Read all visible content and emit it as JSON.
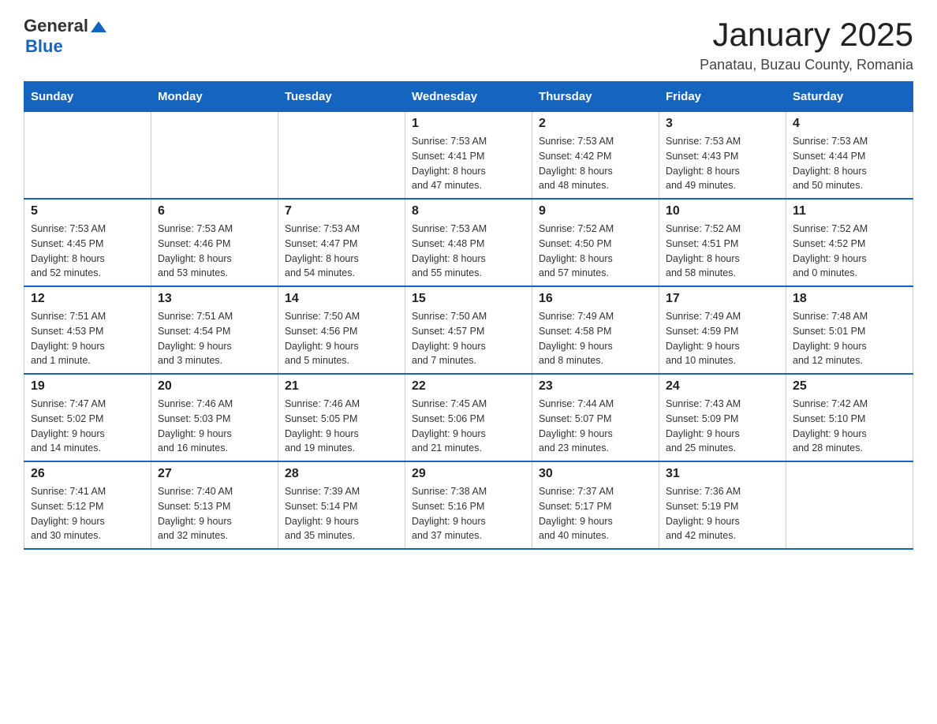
{
  "logo": {
    "text_general": "General",
    "text_blue": "Blue",
    "alt": "GeneralBlue logo"
  },
  "title": "January 2025",
  "subtitle": "Panatau, Buzau County, Romania",
  "days_of_week": [
    "Sunday",
    "Monday",
    "Tuesday",
    "Wednesday",
    "Thursday",
    "Friday",
    "Saturday"
  ],
  "weeks": [
    [
      {
        "day": "",
        "info": ""
      },
      {
        "day": "",
        "info": ""
      },
      {
        "day": "",
        "info": ""
      },
      {
        "day": "1",
        "info": "Sunrise: 7:53 AM\nSunset: 4:41 PM\nDaylight: 8 hours\nand 47 minutes."
      },
      {
        "day": "2",
        "info": "Sunrise: 7:53 AM\nSunset: 4:42 PM\nDaylight: 8 hours\nand 48 minutes."
      },
      {
        "day": "3",
        "info": "Sunrise: 7:53 AM\nSunset: 4:43 PM\nDaylight: 8 hours\nand 49 minutes."
      },
      {
        "day": "4",
        "info": "Sunrise: 7:53 AM\nSunset: 4:44 PM\nDaylight: 8 hours\nand 50 minutes."
      }
    ],
    [
      {
        "day": "5",
        "info": "Sunrise: 7:53 AM\nSunset: 4:45 PM\nDaylight: 8 hours\nand 52 minutes."
      },
      {
        "day": "6",
        "info": "Sunrise: 7:53 AM\nSunset: 4:46 PM\nDaylight: 8 hours\nand 53 minutes."
      },
      {
        "day": "7",
        "info": "Sunrise: 7:53 AM\nSunset: 4:47 PM\nDaylight: 8 hours\nand 54 minutes."
      },
      {
        "day": "8",
        "info": "Sunrise: 7:53 AM\nSunset: 4:48 PM\nDaylight: 8 hours\nand 55 minutes."
      },
      {
        "day": "9",
        "info": "Sunrise: 7:52 AM\nSunset: 4:50 PM\nDaylight: 8 hours\nand 57 minutes."
      },
      {
        "day": "10",
        "info": "Sunrise: 7:52 AM\nSunset: 4:51 PM\nDaylight: 8 hours\nand 58 minutes."
      },
      {
        "day": "11",
        "info": "Sunrise: 7:52 AM\nSunset: 4:52 PM\nDaylight: 9 hours\nand 0 minutes."
      }
    ],
    [
      {
        "day": "12",
        "info": "Sunrise: 7:51 AM\nSunset: 4:53 PM\nDaylight: 9 hours\nand 1 minute."
      },
      {
        "day": "13",
        "info": "Sunrise: 7:51 AM\nSunset: 4:54 PM\nDaylight: 9 hours\nand 3 minutes."
      },
      {
        "day": "14",
        "info": "Sunrise: 7:50 AM\nSunset: 4:56 PM\nDaylight: 9 hours\nand 5 minutes."
      },
      {
        "day": "15",
        "info": "Sunrise: 7:50 AM\nSunset: 4:57 PM\nDaylight: 9 hours\nand 7 minutes."
      },
      {
        "day": "16",
        "info": "Sunrise: 7:49 AM\nSunset: 4:58 PM\nDaylight: 9 hours\nand 8 minutes."
      },
      {
        "day": "17",
        "info": "Sunrise: 7:49 AM\nSunset: 4:59 PM\nDaylight: 9 hours\nand 10 minutes."
      },
      {
        "day": "18",
        "info": "Sunrise: 7:48 AM\nSunset: 5:01 PM\nDaylight: 9 hours\nand 12 minutes."
      }
    ],
    [
      {
        "day": "19",
        "info": "Sunrise: 7:47 AM\nSunset: 5:02 PM\nDaylight: 9 hours\nand 14 minutes."
      },
      {
        "day": "20",
        "info": "Sunrise: 7:46 AM\nSunset: 5:03 PM\nDaylight: 9 hours\nand 16 minutes."
      },
      {
        "day": "21",
        "info": "Sunrise: 7:46 AM\nSunset: 5:05 PM\nDaylight: 9 hours\nand 19 minutes."
      },
      {
        "day": "22",
        "info": "Sunrise: 7:45 AM\nSunset: 5:06 PM\nDaylight: 9 hours\nand 21 minutes."
      },
      {
        "day": "23",
        "info": "Sunrise: 7:44 AM\nSunset: 5:07 PM\nDaylight: 9 hours\nand 23 minutes."
      },
      {
        "day": "24",
        "info": "Sunrise: 7:43 AM\nSunset: 5:09 PM\nDaylight: 9 hours\nand 25 minutes."
      },
      {
        "day": "25",
        "info": "Sunrise: 7:42 AM\nSunset: 5:10 PM\nDaylight: 9 hours\nand 28 minutes."
      }
    ],
    [
      {
        "day": "26",
        "info": "Sunrise: 7:41 AM\nSunset: 5:12 PM\nDaylight: 9 hours\nand 30 minutes."
      },
      {
        "day": "27",
        "info": "Sunrise: 7:40 AM\nSunset: 5:13 PM\nDaylight: 9 hours\nand 32 minutes."
      },
      {
        "day": "28",
        "info": "Sunrise: 7:39 AM\nSunset: 5:14 PM\nDaylight: 9 hours\nand 35 minutes."
      },
      {
        "day": "29",
        "info": "Sunrise: 7:38 AM\nSunset: 5:16 PM\nDaylight: 9 hours\nand 37 minutes."
      },
      {
        "day": "30",
        "info": "Sunrise: 7:37 AM\nSunset: 5:17 PM\nDaylight: 9 hours\nand 40 minutes."
      },
      {
        "day": "31",
        "info": "Sunrise: 7:36 AM\nSunset: 5:19 PM\nDaylight: 9 hours\nand 42 minutes."
      },
      {
        "day": "",
        "info": ""
      }
    ]
  ]
}
